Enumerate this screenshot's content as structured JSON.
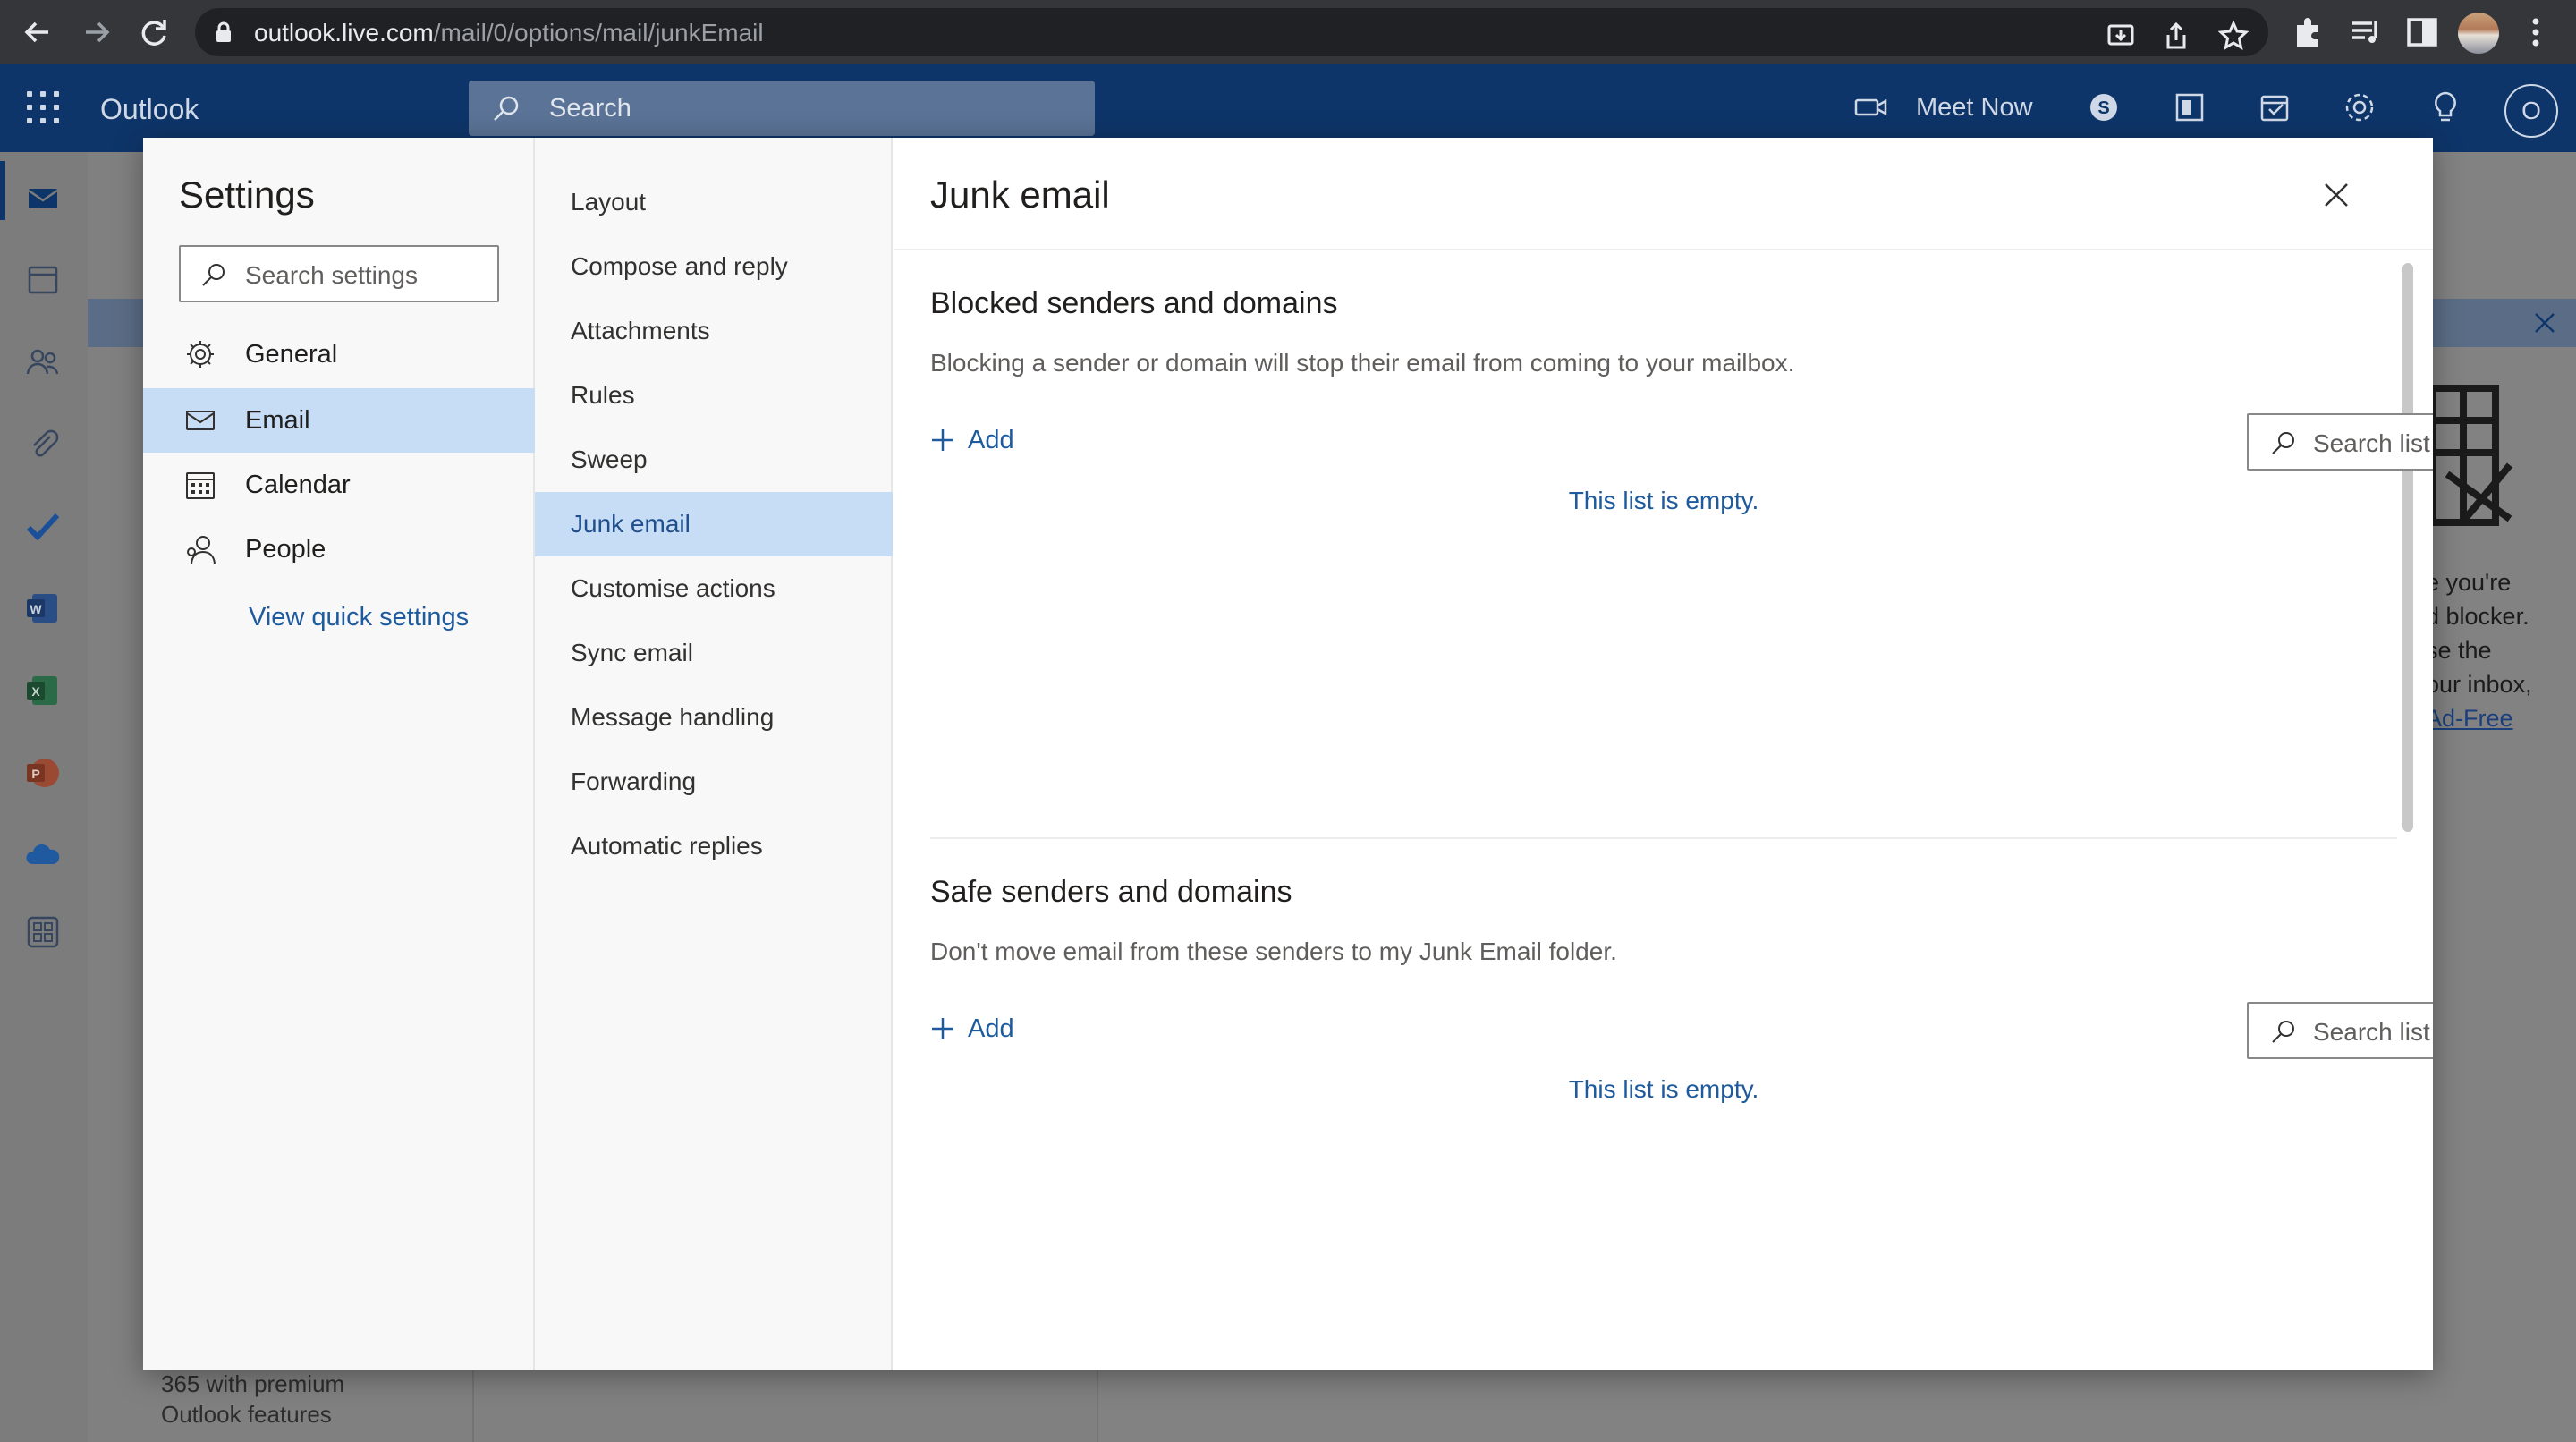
{
  "browser": {
    "url_host": "outlook.live.com",
    "url_path": "/mail/0/options/mail/junkEmail"
  },
  "header": {
    "app_name": "Outlook",
    "search_placeholder": "Search",
    "meet_now": "Meet Now",
    "avatar_initial": "O"
  },
  "background": {
    "premium_line1": "365 with premium",
    "premium_line2": "Outlook features",
    "ad_lines": [
      "e you're",
      "d blocker.",
      "se the",
      "our inbox,"
    ],
    "ad_link": "Ad-Free"
  },
  "settings": {
    "title": "Settings",
    "search_placeholder": "Search settings",
    "categories": [
      {
        "label": "General",
        "icon": "gear-icon"
      },
      {
        "label": "Email",
        "icon": "mail-icon",
        "selected": true
      },
      {
        "label": "Calendar",
        "icon": "calendar-icon"
      },
      {
        "label": "People",
        "icon": "people-icon"
      }
    ],
    "quick_settings_link": "View quick settings",
    "email_subcategories": [
      {
        "label": "Layout"
      },
      {
        "label": "Compose and reply"
      },
      {
        "label": "Attachments"
      },
      {
        "label": "Rules"
      },
      {
        "label": "Sweep"
      },
      {
        "label": "Junk email",
        "selected": true
      },
      {
        "label": "Customise actions"
      },
      {
        "label": "Sync email"
      },
      {
        "label": "Message handling"
      },
      {
        "label": "Forwarding"
      },
      {
        "label": "Automatic replies"
      }
    ]
  },
  "junk": {
    "title": "Junk email",
    "blocked": {
      "title": "Blocked senders and domains",
      "description": "Blocking a sender or domain will stop their email from coming to your mailbox.",
      "add_label": "Add",
      "search_placeholder": "Search list",
      "empty_text": "This list is empty."
    },
    "safe": {
      "title": "Safe senders and domains",
      "description": "Don't move email from these senders to my Junk Email folder.",
      "add_label": "Add",
      "search_placeholder": "Search list",
      "empty_text": "This list is empty."
    }
  }
}
